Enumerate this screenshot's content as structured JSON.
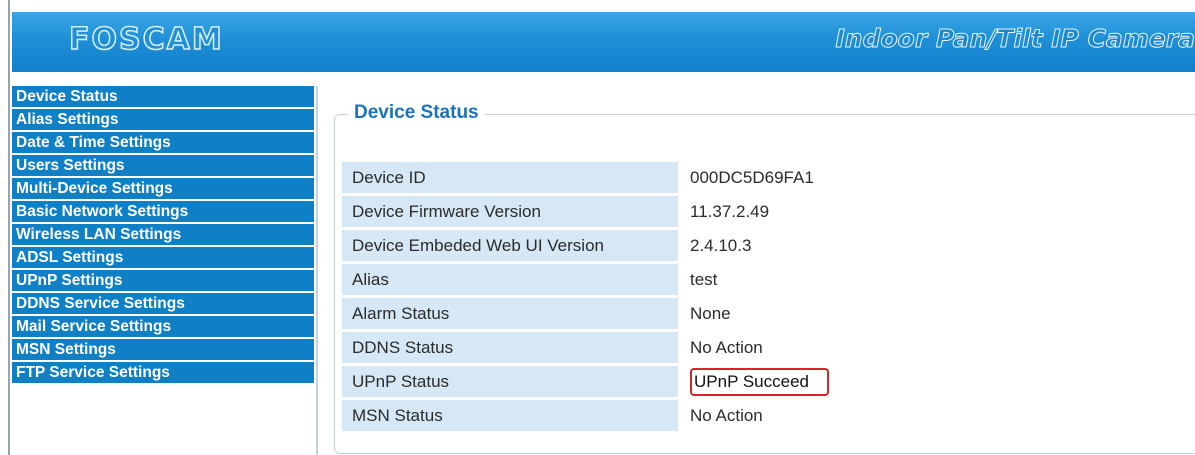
{
  "header": {
    "logo": "FOSCAM",
    "product_name": "Indoor Pan/Tilt IP Camera"
  },
  "sidebar": {
    "items": [
      {
        "label": "Device Status"
      },
      {
        "label": "Alias Settings"
      },
      {
        "label": "Date & Time Settings"
      },
      {
        "label": "Users Settings"
      },
      {
        "label": "Multi-Device Settings"
      },
      {
        "label": "Basic Network Settings"
      },
      {
        "label": "Wireless LAN Settings"
      },
      {
        "label": "ADSL Settings"
      },
      {
        "label": "UPnP Settings"
      },
      {
        "label": "DDNS Service Settings"
      },
      {
        "label": "Mail Service Settings"
      },
      {
        "label": "MSN Settings"
      },
      {
        "label": "FTP Service Settings"
      }
    ]
  },
  "main": {
    "section_title": "Device Status",
    "rows": [
      {
        "label": "Device ID",
        "value": "000DC5D69FA1"
      },
      {
        "label": "Device Firmware Version",
        "value": "11.37.2.49"
      },
      {
        "label": "Device Embeded Web UI Version",
        "value": "2.4.10.3"
      },
      {
        "label": "Alias",
        "value": "test"
      },
      {
        "label": "Alarm Status",
        "value": "None"
      },
      {
        "label": "DDNS Status",
        "value": "No Action"
      },
      {
        "label": "UPnP Status",
        "value": "UPnP Succeed"
      },
      {
        "label": "MSN Status",
        "value": "No Action"
      }
    ]
  },
  "colors": {
    "header_blue": "#1f8fd7",
    "menu_blue": "#0f7fc6",
    "label_cell_bg": "#d6e8f6",
    "title_blue": "#1d72b8",
    "highlight_red": "#d4252b"
  }
}
